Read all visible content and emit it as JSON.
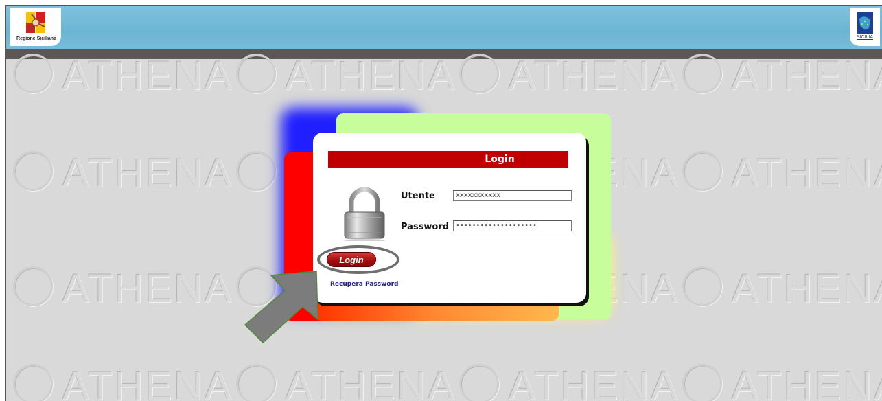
{
  "header": {
    "left_logo_caption": "Regione Siciliana",
    "right_logo_caption": "SICILIA",
    "colors": {
      "banner": "#7fc2dc",
      "strip": "#5c5654"
    }
  },
  "background": {
    "watermark_text": "ATHENA",
    "colors": {
      "page": "#d9d9d9"
    }
  },
  "login": {
    "title": "Login",
    "username_label": "Utente",
    "username_value": "xxxxxxxxxxx",
    "password_label": "Password",
    "password_value": "••••••••••••••••••••",
    "submit_label": "Login",
    "recover_label": "Recupera Password",
    "lock_icon": "padlock-icon",
    "colors": {
      "title_bar": "#c00000",
      "button": "#a50f0f",
      "link": "#1f1f9a"
    }
  },
  "annotation": {
    "arrow_icon": "pointer-arrow-icon",
    "highlight": "ring around login button"
  }
}
